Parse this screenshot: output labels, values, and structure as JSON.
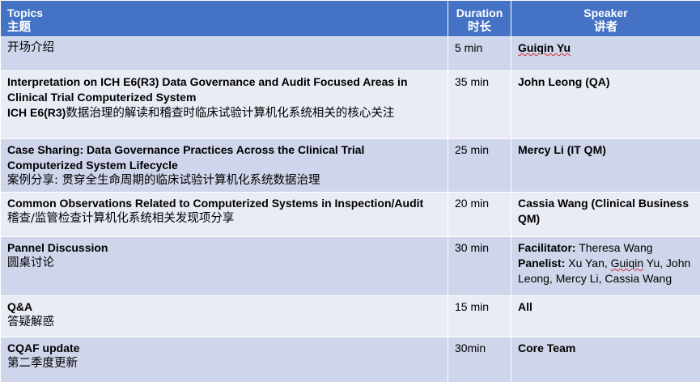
{
  "header": {
    "topics_en": "Topics",
    "topics_cn": "主题",
    "duration_en": "Duration",
    "duration_cn": "时长",
    "speaker_en": "Speaker",
    "speaker_cn": "讲者"
  },
  "rows": [
    {
      "topic_cn": "开场介绍",
      "duration": "5 min",
      "speaker": "Guiqin Yu"
    },
    {
      "topic_en": "Interpretation on ICH E6(R3) Data Governance and Audit Focused Areas in Clinical Trial Computerized System",
      "topic_cn_prefix": "ICH E6(R3)",
      "topic_cn_rest": "数据治理的解读和稽查时临床试验计算机化系统相关的核心关注",
      "duration": "35 min",
      "speaker": "John Leong (QA)"
    },
    {
      "topic_en": "Case Sharing: Data Governance Practices Across the Clinical Trial Computerized System Lifecycle",
      "topic_cn": "案例分享: 贯穿全生命周期的临床试验计算机化系统数据治理",
      "duration": "25 min",
      "speaker": "Mercy Li (IT QM)"
    },
    {
      "topic_en": "Common Observations Related to Computerized Systems in Inspection/Audit",
      "topic_cn": "稽查/监管检查计算机化系统相关发现项分享",
      "duration": "20 min",
      "speaker": "Cassia Wang (Clinical Business QM)"
    },
    {
      "topic_en": "Pannel Discussion",
      "topic_cn": "圆桌讨论",
      "duration": "30 min",
      "facilitator_label": "Facilitator:",
      "facilitator": " Theresa Wang",
      "panelist_label": "Panelist:",
      "panelist_a": " Xu Yan, ",
      "panelist_b": "Guiqin",
      "panelist_c": " Yu, John Leong, Mercy Li, Cassia Wang"
    },
    {
      "topic_en": "Q&A",
      "topic_cn": "答疑解惑",
      "duration": "15 min",
      "speaker": "All"
    },
    {
      "topic_en": "CQAF update",
      "topic_cn": "第二季度更新",
      "duration": "30min",
      "speaker": "Core Team"
    }
  ]
}
